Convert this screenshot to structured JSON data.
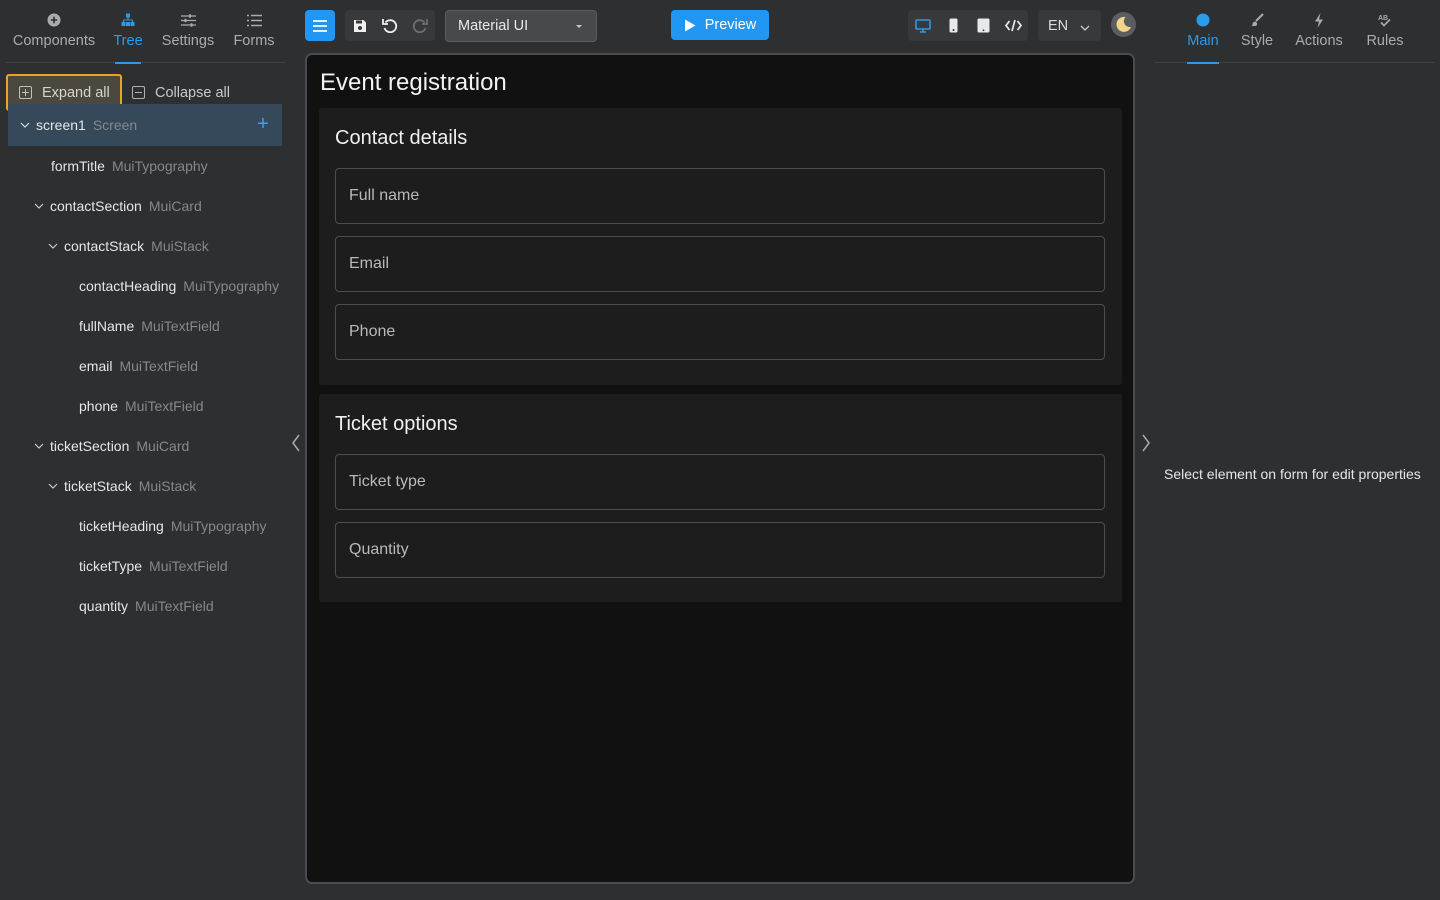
{
  "left_tabs": [
    {
      "label": "Components",
      "icon": "add-circle-icon"
    },
    {
      "label": "Tree",
      "icon": "tree-icon",
      "active": true
    },
    {
      "label": "Settings",
      "icon": "sliders-icon"
    },
    {
      "label": "Forms",
      "icon": "list-icon"
    }
  ],
  "tree_actions": {
    "expand_all": "Expand all",
    "collapse_all": "Collapse all"
  },
  "tree": [
    {
      "name": "screen1",
      "type": "Screen",
      "expanded": true,
      "selected": true
    },
    {
      "name": "formTitle",
      "type": "MuiTypography"
    },
    {
      "name": "contactSection",
      "type": "MuiCard",
      "expanded": true
    },
    {
      "name": "contactStack",
      "type": "MuiStack",
      "expanded": true
    },
    {
      "name": "contactHeading",
      "type": "MuiTypography"
    },
    {
      "name": "fullName",
      "type": "MuiTextField"
    },
    {
      "name": "email",
      "type": "MuiTextField"
    },
    {
      "name": "phone",
      "type": "MuiTextField"
    },
    {
      "name": "ticketSection",
      "type": "MuiCard",
      "expanded": true
    },
    {
      "name": "ticketStack",
      "type": "MuiStack",
      "expanded": true
    },
    {
      "name": "ticketHeading",
      "type": "MuiTypography"
    },
    {
      "name": "ticketType",
      "type": "MuiTextField"
    },
    {
      "name": "quantity",
      "type": "MuiTextField"
    }
  ],
  "toolbar": {
    "ui_library": "Material UI",
    "preview_label": "Preview",
    "language": "EN"
  },
  "form": {
    "title": "Event registration",
    "contact": {
      "heading": "Contact details",
      "fields": [
        "Full name",
        "Email",
        "Phone"
      ]
    },
    "ticket": {
      "heading": "Ticket options",
      "fields": [
        "Ticket type",
        "Quantity"
      ]
    }
  },
  "right_tabs": [
    {
      "label": "Main",
      "icon": "dot-icon",
      "active": true
    },
    {
      "label": "Style",
      "icon": "brush-icon"
    },
    {
      "label": "Actions",
      "icon": "lightning-icon"
    },
    {
      "label": "Rules",
      "icon": "rules-icon"
    }
  ],
  "properties": {
    "empty_message": "Select element on form for edit properties"
  },
  "colors": {
    "accent": "#2196f3",
    "highlight": "#e8a32a",
    "background": "#2d2f31",
    "canvas": "#111111"
  }
}
